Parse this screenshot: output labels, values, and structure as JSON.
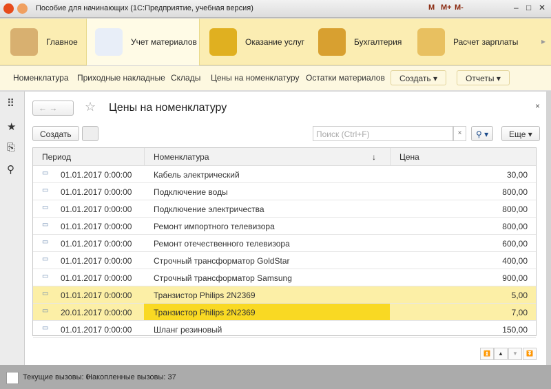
{
  "window": {
    "title": "Пособие для начинающих  (1С:Предприятие, учебная версия)",
    "mem": [
      "M",
      "M+",
      "M-"
    ]
  },
  "sections": [
    {
      "label": "Главное"
    },
    {
      "label": "Учет материалов"
    },
    {
      "label": "Оказание услуг"
    },
    {
      "label": "Бухгалтерия"
    },
    {
      "label": "Расчет зарплаты"
    }
  ],
  "subnav": {
    "links": [
      "Номенклатура",
      "Приходные накладные",
      "Склады",
      "Цены на номенклатуру",
      "Остатки материалов"
    ],
    "create": "Создать",
    "reports": "Отчеты"
  },
  "form": {
    "title": "Цены на номенклатуру",
    "create": "Создать",
    "search_placeholder": "Поиск (Ctrl+F)",
    "more": "Еще",
    "clear": "×",
    "close": "×"
  },
  "table": {
    "headers": [
      "Период",
      "Номенклатура",
      "Цена"
    ],
    "rows": [
      {
        "period": "01.01.2017 0:00:00",
        "item": "Кабель электрический",
        "price": "30,00"
      },
      {
        "period": "01.01.2017 0:00:00",
        "item": "Подключение воды",
        "price": "800,00"
      },
      {
        "period": "01.01.2017 0:00:00",
        "item": "Подключение электричества",
        "price": "800,00"
      },
      {
        "period": "01.01.2017 0:00:00",
        "item": "Ремонт импортного телевизора",
        "price": "800,00"
      },
      {
        "period": "01.01.2017 0:00:00",
        "item": "Ремонт отечественного телевизора",
        "price": "600,00"
      },
      {
        "period": "01.01.2017 0:00:00",
        "item": "Строчный трансформатор GoldStar",
        "price": "400,00"
      },
      {
        "period": "01.01.2017 0:00:00",
        "item": "Строчный трансформатор Samsung",
        "price": "900,00"
      },
      {
        "period": "01.01.2017 0:00:00",
        "item": "Транзистор Philips 2N2369",
        "price": "5,00"
      },
      {
        "period": "20.01.2017 0:00:00",
        "item": "Транзистор Philips 2N2369",
        "price": "7,00"
      },
      {
        "period": "01.01.2017 0:00:00",
        "item": "Шланг резиновый",
        "price": "150,00"
      }
    ]
  },
  "status": {
    "current": "Текущие вызовы: 0",
    "accumulated": "Накопленные вызовы: 37"
  }
}
